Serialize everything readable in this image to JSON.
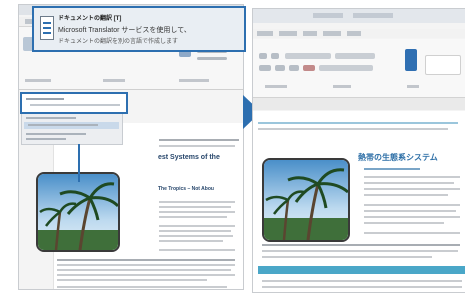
{
  "tooltip": {
    "title": "ドキュメントの翻訳 [T]",
    "desc1": "Microsoft Translator サービスを使用して、",
    "desc2": "ドキュメントの翻訳を別の言語で作成します"
  },
  "source_doc": {
    "heading": "est Systems of the",
    "subheading": "The Tropics – Not Abou"
  },
  "translated_doc": {
    "heading": "熱帯の生態系システム"
  },
  "colors": {
    "accent": "#2d6fb0",
    "table_header": "#4aa7c8",
    "heading_blue": "#2c6ea6"
  }
}
